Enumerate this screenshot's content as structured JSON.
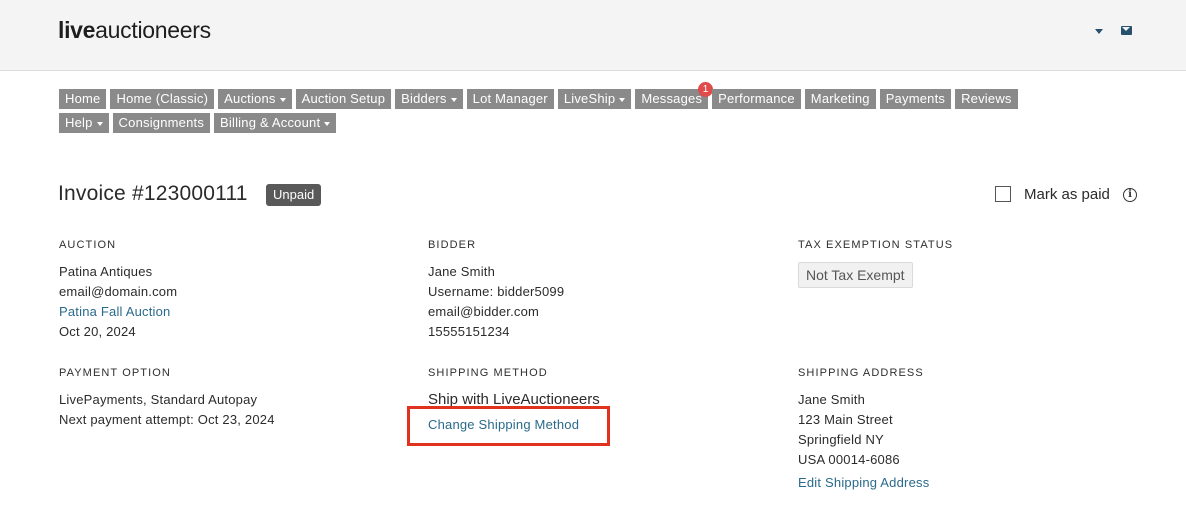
{
  "header": {
    "logo_bold": "live",
    "logo_light": "auctioneers",
    "user_menu_icon": "chevron-down-icon",
    "mail_icon": "envelope-icon"
  },
  "nav": {
    "row1": [
      {
        "label": "Home",
        "dropdown": false
      },
      {
        "label": "Home (Classic)",
        "dropdown": false
      },
      {
        "label": "Auctions",
        "dropdown": true
      },
      {
        "label": "Auction Setup",
        "dropdown": false
      },
      {
        "label": "Bidders",
        "dropdown": true
      },
      {
        "label": "Lot Manager",
        "dropdown": false
      },
      {
        "label": "LiveShip",
        "dropdown": true
      },
      {
        "label": "Messages",
        "dropdown": false,
        "badge": "1"
      },
      {
        "label": "Performance",
        "dropdown": false
      },
      {
        "label": "Marketing",
        "dropdown": false
      },
      {
        "label": "Payments",
        "dropdown": false
      },
      {
        "label": "Reviews",
        "dropdown": false
      }
    ],
    "row2": [
      {
        "label": "Help",
        "dropdown": true
      },
      {
        "label": "Consignments",
        "dropdown": false
      },
      {
        "label": "Billing & Account",
        "dropdown": true
      }
    ]
  },
  "invoice": {
    "title": "Invoice #123000111",
    "status": "Unpaid",
    "mark_paid_label": "Mark as paid",
    "mark_paid_checked": false,
    "info_glyph": "i"
  },
  "auction": {
    "heading": "AUCTION",
    "house": "Patina Antiques",
    "email": "email@domain.com",
    "auction_name": "Patina Fall Auction",
    "date": "Oct 20, 2024"
  },
  "bidder": {
    "heading": "BIDDER",
    "name": "Jane Smith",
    "username": "Username: bidder5099",
    "email": "email@bidder.com",
    "phone": "15555151234"
  },
  "tax": {
    "heading": "TAX EXEMPTION STATUS",
    "status": "Not Tax Exempt"
  },
  "payment": {
    "heading": "PAYMENT OPTION",
    "method": "LivePayments, Standard Autopay",
    "next_attempt": "Next payment attempt: Oct 23, 2024"
  },
  "shipping_method": {
    "heading": "SHIPPING METHOD",
    "value": "Ship with LiveAuctioneers",
    "change_label": "Change Shipping Method"
  },
  "shipping_address": {
    "heading": "SHIPPING ADDRESS",
    "name": "Jane Smith",
    "street": "123 Main Street",
    "city": "Springfield NY",
    "country_zip": "USA 00014-6086",
    "edit_label": "Edit Shipping Address"
  },
  "colors": {
    "nav_bg": "#8a8a8a",
    "link": "#2a6a8c",
    "badge_red": "#e04b4b",
    "highlight": "#e0321e"
  }
}
